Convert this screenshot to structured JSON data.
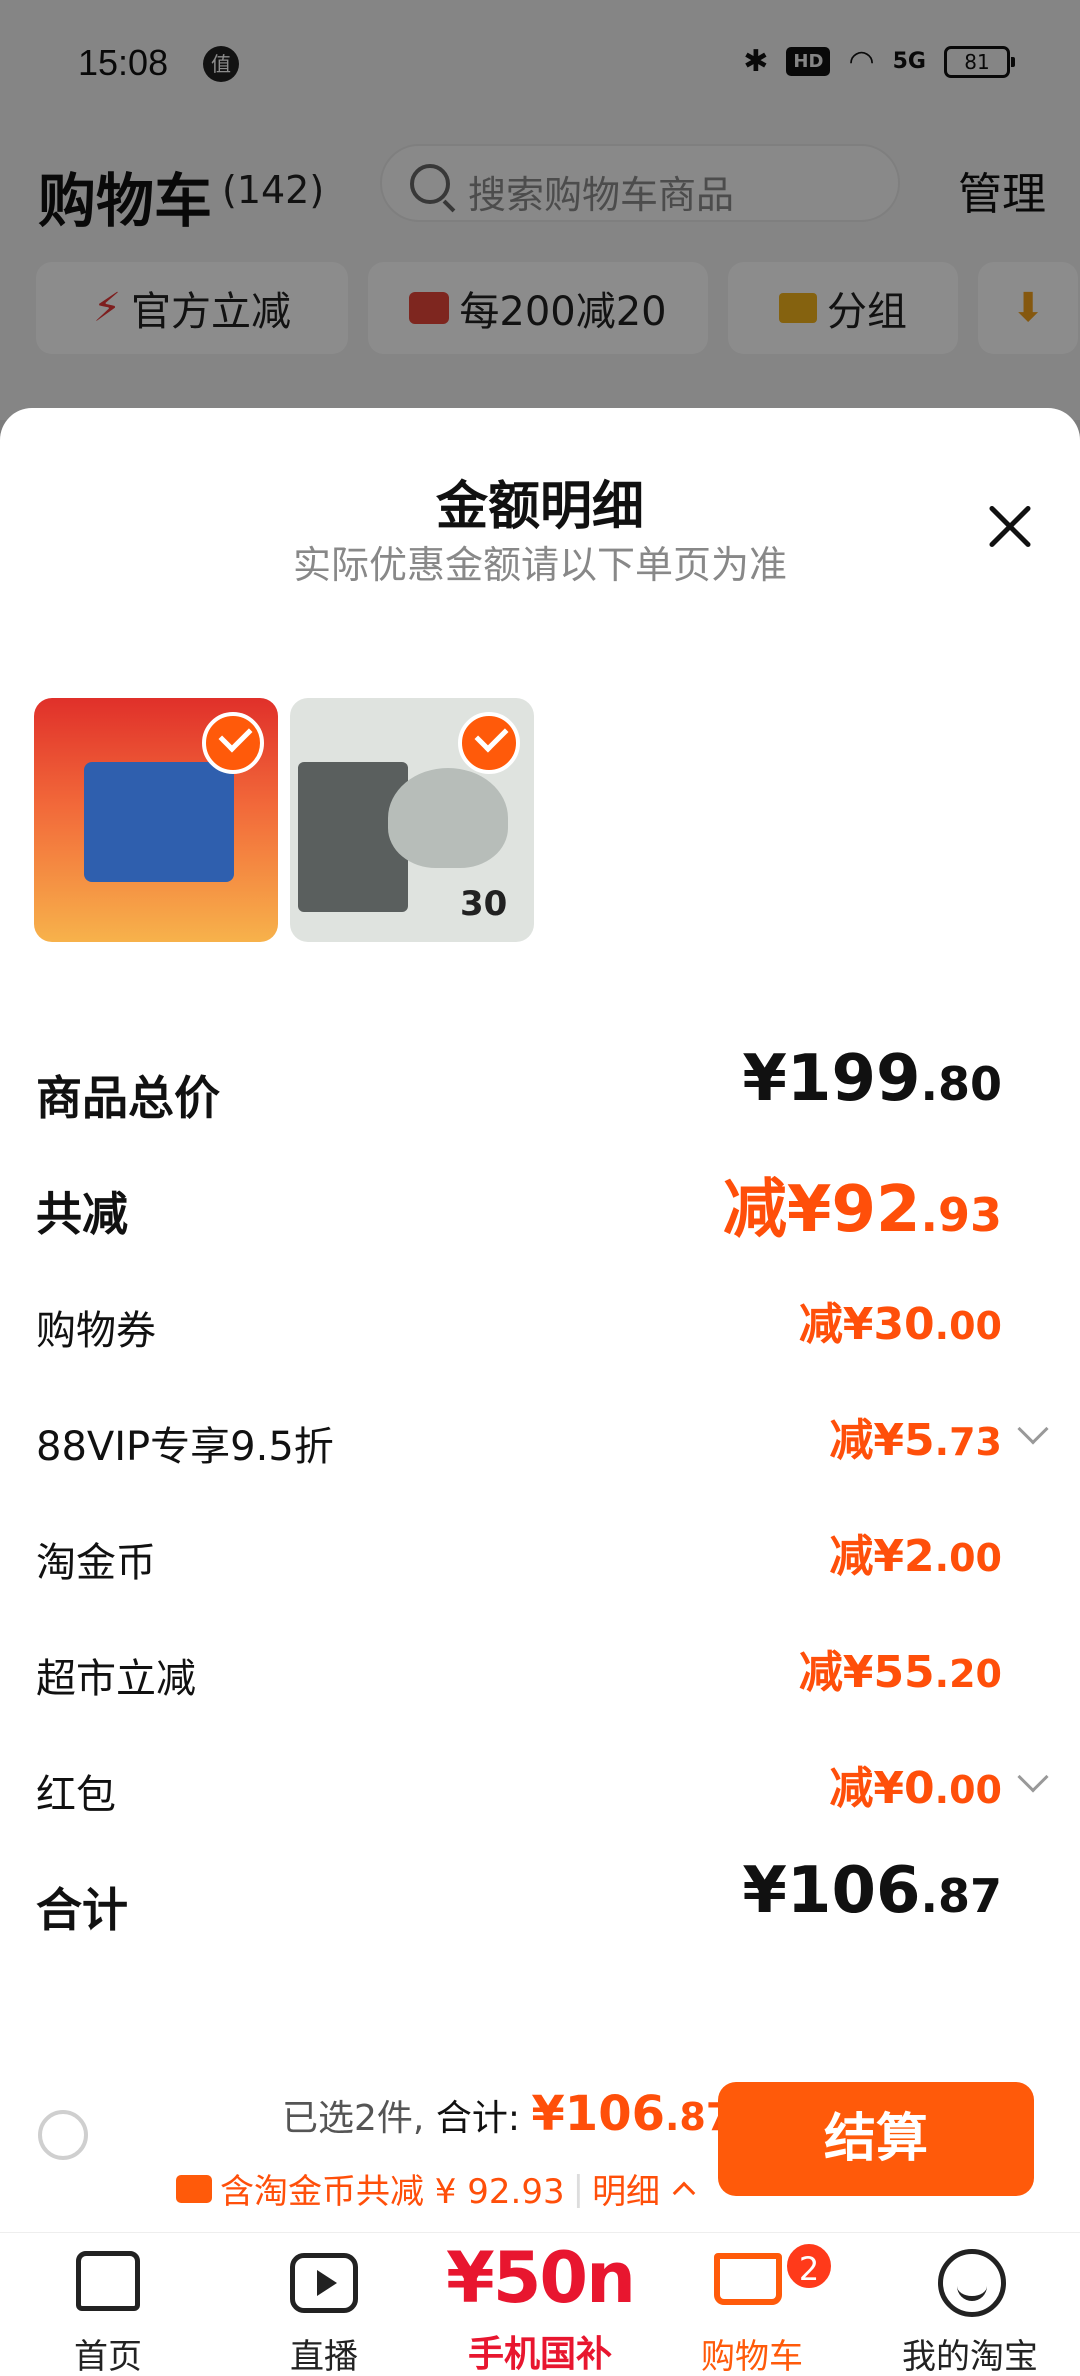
{
  "status_bar": {
    "time": "15:08",
    "zhi_badge": "值",
    "hd": "HD",
    "network": "5G",
    "battery": "81"
  },
  "cart_header": {
    "title": "购物车",
    "count": "(142)",
    "search_placeholder": "搜索购物车商品",
    "manage": "管理"
  },
  "filter_chips": [
    "官方立减",
    "每200减20",
    "分组"
  ],
  "sheet": {
    "title": "金额明细",
    "subtitle": "实际优惠金额请以下单页为准",
    "products": [
      {
        "name": "tmall-supermarket-gift-box",
        "selected": true
      },
      {
        "name": "3d-face-mask-30",
        "thumb_text": "30",
        "selected": true
      }
    ],
    "rows": [
      {
        "label": "商品总价",
        "prefix": "¥",
        "int": "199",
        "dec": ".80"
      },
      {
        "label": "共减",
        "prefix": "减¥",
        "int": "92",
        "dec": ".93"
      },
      {
        "label": "购物券",
        "prefix": "减¥",
        "int": "30",
        "dec": ".00"
      },
      {
        "label": "88VIP专享9.5折",
        "prefix": "减¥",
        "int": "5",
        "dec": ".73"
      },
      {
        "label": "淘金币",
        "prefix": "减¥",
        "int": "2",
        "dec": ".00"
      },
      {
        "label": "超市立减",
        "prefix": "减¥",
        "int": "55",
        "dec": ".20"
      },
      {
        "label": "红包",
        "prefix": "减¥",
        "int": "0",
        "dec": ".00"
      },
      {
        "label": "合计",
        "prefix": "¥",
        "int": "106",
        "dec": ".87"
      }
    ]
  },
  "checkout": {
    "selected_text": "已选2件,",
    "total_label": "合计:",
    "total_int": "¥106",
    "total_dec": ".87",
    "discount_text": "含淘金币共减 ¥ 92.93",
    "detail_link": "明细",
    "button": "结算"
  },
  "tabs": [
    {
      "label": "首页"
    },
    {
      "label": "直播"
    },
    {
      "label": "手机国补",
      "big": "¥50n"
    },
    {
      "label": "购物车",
      "badge": "2"
    },
    {
      "label": "我的淘宝"
    }
  ],
  "colors": {
    "accent": "#ff5a0a",
    "discount": "#ff4f0a",
    "promo_red": "#e8162f"
  }
}
